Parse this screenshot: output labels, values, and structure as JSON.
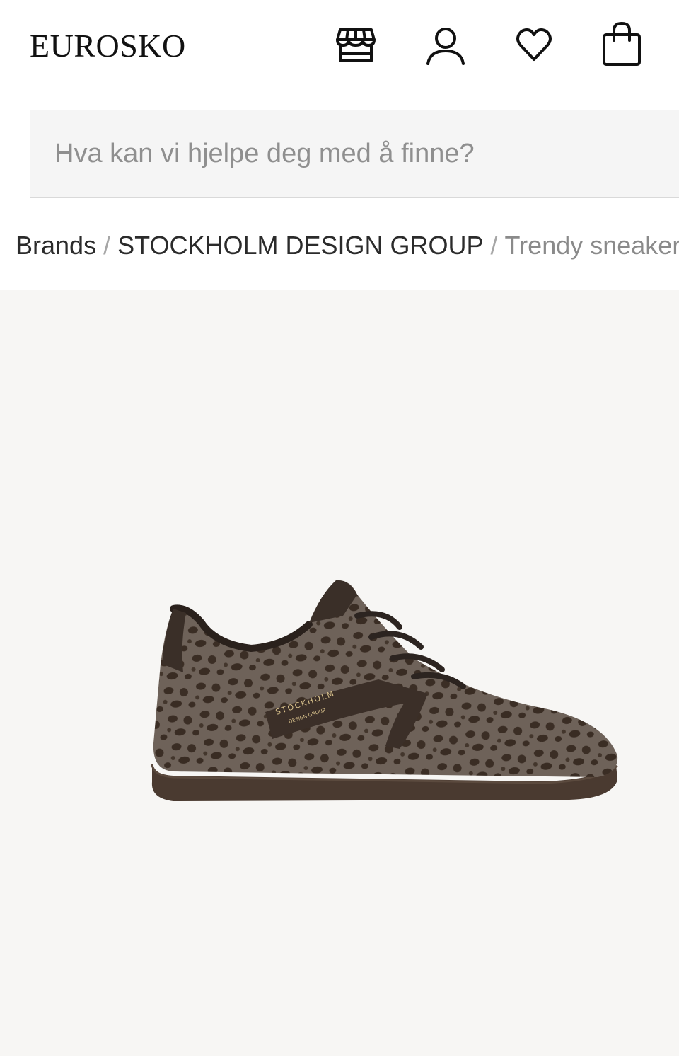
{
  "header": {
    "logo": "EUROSKO",
    "icons": [
      "store-icon",
      "account-icon",
      "wishlist-heart-icon",
      "shopping-bag-icon"
    ]
  },
  "search": {
    "placeholder": "Hva kan vi hjelpe deg med å finne?",
    "value": ""
  },
  "breadcrumb": {
    "items": [
      "Brands",
      "STOCKHOLM DESIGN GROUP",
      "Trendy sneakers"
    ],
    "separator": "/"
  },
  "product": {
    "image_text": "STOCKHOLM",
    "image_subtext": "DESIGN GROUP"
  },
  "colors": {
    "text": "#2b2b2b",
    "muted": "#8a8a8a",
    "search_bg": "#f5f5f5",
    "product_bg": "#f7f6f4"
  }
}
